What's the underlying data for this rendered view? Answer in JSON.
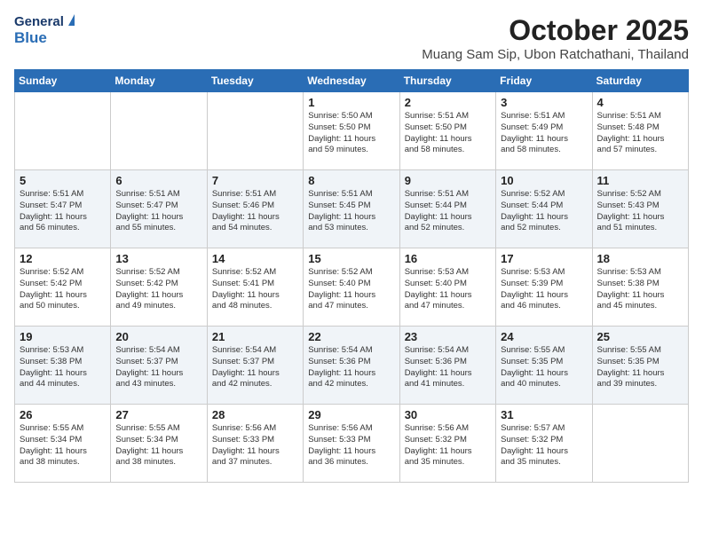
{
  "header": {
    "logo_general": "General",
    "logo_blue": "Blue",
    "month": "October 2025",
    "location": "Muang Sam Sip, Ubon Ratchathani, Thailand"
  },
  "weekdays": [
    "Sunday",
    "Monday",
    "Tuesday",
    "Wednesday",
    "Thursday",
    "Friday",
    "Saturday"
  ],
  "weeks": [
    [
      {
        "day": "",
        "text": ""
      },
      {
        "day": "",
        "text": ""
      },
      {
        "day": "",
        "text": ""
      },
      {
        "day": "1",
        "text": "Sunrise: 5:50 AM\nSunset: 5:50 PM\nDaylight: 11 hours\nand 59 minutes."
      },
      {
        "day": "2",
        "text": "Sunrise: 5:51 AM\nSunset: 5:50 PM\nDaylight: 11 hours\nand 58 minutes."
      },
      {
        "day": "3",
        "text": "Sunrise: 5:51 AM\nSunset: 5:49 PM\nDaylight: 11 hours\nand 58 minutes."
      },
      {
        "day": "4",
        "text": "Sunrise: 5:51 AM\nSunset: 5:48 PM\nDaylight: 11 hours\nand 57 minutes."
      }
    ],
    [
      {
        "day": "5",
        "text": "Sunrise: 5:51 AM\nSunset: 5:47 PM\nDaylight: 11 hours\nand 56 minutes."
      },
      {
        "day": "6",
        "text": "Sunrise: 5:51 AM\nSunset: 5:47 PM\nDaylight: 11 hours\nand 55 minutes."
      },
      {
        "day": "7",
        "text": "Sunrise: 5:51 AM\nSunset: 5:46 PM\nDaylight: 11 hours\nand 54 minutes."
      },
      {
        "day": "8",
        "text": "Sunrise: 5:51 AM\nSunset: 5:45 PM\nDaylight: 11 hours\nand 53 minutes."
      },
      {
        "day": "9",
        "text": "Sunrise: 5:51 AM\nSunset: 5:44 PM\nDaylight: 11 hours\nand 52 minutes."
      },
      {
        "day": "10",
        "text": "Sunrise: 5:52 AM\nSunset: 5:44 PM\nDaylight: 11 hours\nand 52 minutes."
      },
      {
        "day": "11",
        "text": "Sunrise: 5:52 AM\nSunset: 5:43 PM\nDaylight: 11 hours\nand 51 minutes."
      }
    ],
    [
      {
        "day": "12",
        "text": "Sunrise: 5:52 AM\nSunset: 5:42 PM\nDaylight: 11 hours\nand 50 minutes."
      },
      {
        "day": "13",
        "text": "Sunrise: 5:52 AM\nSunset: 5:42 PM\nDaylight: 11 hours\nand 49 minutes."
      },
      {
        "day": "14",
        "text": "Sunrise: 5:52 AM\nSunset: 5:41 PM\nDaylight: 11 hours\nand 48 minutes."
      },
      {
        "day": "15",
        "text": "Sunrise: 5:52 AM\nSunset: 5:40 PM\nDaylight: 11 hours\nand 47 minutes."
      },
      {
        "day": "16",
        "text": "Sunrise: 5:53 AM\nSunset: 5:40 PM\nDaylight: 11 hours\nand 47 minutes."
      },
      {
        "day": "17",
        "text": "Sunrise: 5:53 AM\nSunset: 5:39 PM\nDaylight: 11 hours\nand 46 minutes."
      },
      {
        "day": "18",
        "text": "Sunrise: 5:53 AM\nSunset: 5:38 PM\nDaylight: 11 hours\nand 45 minutes."
      }
    ],
    [
      {
        "day": "19",
        "text": "Sunrise: 5:53 AM\nSunset: 5:38 PM\nDaylight: 11 hours\nand 44 minutes."
      },
      {
        "day": "20",
        "text": "Sunrise: 5:54 AM\nSunset: 5:37 PM\nDaylight: 11 hours\nand 43 minutes."
      },
      {
        "day": "21",
        "text": "Sunrise: 5:54 AM\nSunset: 5:37 PM\nDaylight: 11 hours\nand 42 minutes."
      },
      {
        "day": "22",
        "text": "Sunrise: 5:54 AM\nSunset: 5:36 PM\nDaylight: 11 hours\nand 42 minutes."
      },
      {
        "day": "23",
        "text": "Sunrise: 5:54 AM\nSunset: 5:36 PM\nDaylight: 11 hours\nand 41 minutes."
      },
      {
        "day": "24",
        "text": "Sunrise: 5:55 AM\nSunset: 5:35 PM\nDaylight: 11 hours\nand 40 minutes."
      },
      {
        "day": "25",
        "text": "Sunrise: 5:55 AM\nSunset: 5:35 PM\nDaylight: 11 hours\nand 39 minutes."
      }
    ],
    [
      {
        "day": "26",
        "text": "Sunrise: 5:55 AM\nSunset: 5:34 PM\nDaylight: 11 hours\nand 38 minutes."
      },
      {
        "day": "27",
        "text": "Sunrise: 5:55 AM\nSunset: 5:34 PM\nDaylight: 11 hours\nand 38 minutes."
      },
      {
        "day": "28",
        "text": "Sunrise: 5:56 AM\nSunset: 5:33 PM\nDaylight: 11 hours\nand 37 minutes."
      },
      {
        "day": "29",
        "text": "Sunrise: 5:56 AM\nSunset: 5:33 PM\nDaylight: 11 hours\nand 36 minutes."
      },
      {
        "day": "30",
        "text": "Sunrise: 5:56 AM\nSunset: 5:32 PM\nDaylight: 11 hours\nand 35 minutes."
      },
      {
        "day": "31",
        "text": "Sunrise: 5:57 AM\nSunset: 5:32 PM\nDaylight: 11 hours\nand 35 minutes."
      },
      {
        "day": "",
        "text": ""
      }
    ]
  ]
}
